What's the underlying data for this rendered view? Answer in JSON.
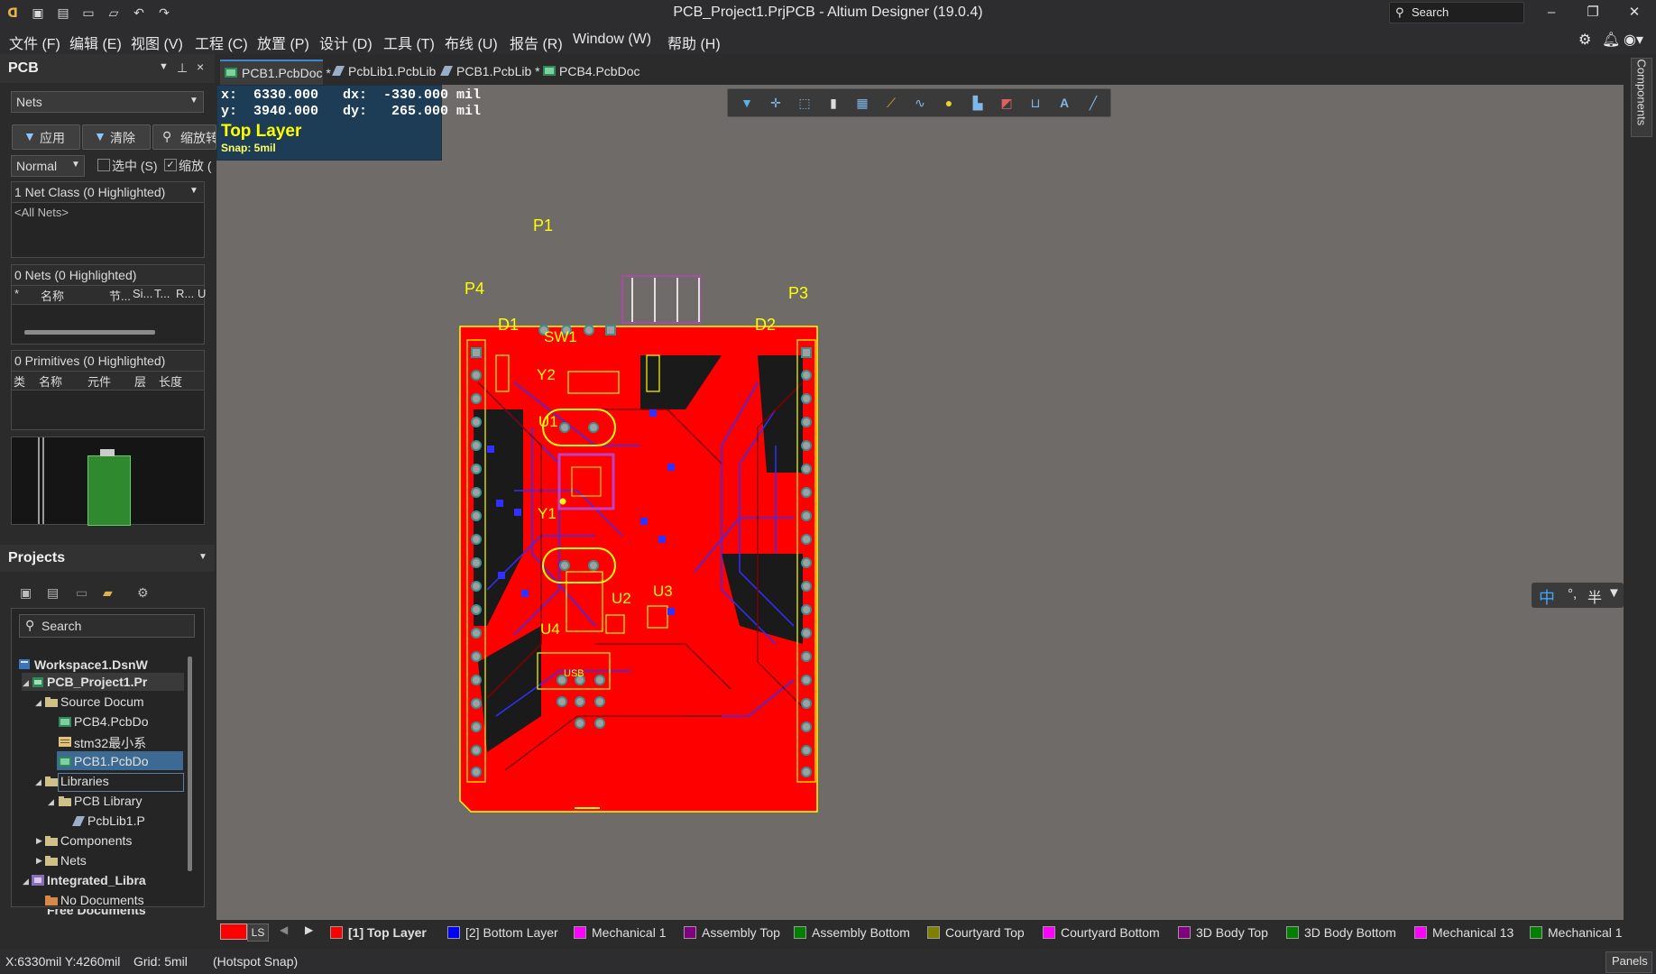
{
  "app": {
    "title": "PCB_Project1.PrjPCB - Altium Designer (19.0.4)",
    "search_placeholder": "Search"
  },
  "menu": [
    "文件 (F)",
    "编辑 (E)",
    "视图 (V)",
    "工程 (C)",
    "放置 (P)",
    "设计 (D)",
    "工具 (T)",
    "布线 (U)",
    "报告 (R)",
    "Window (W)",
    "帮助 (H)"
  ],
  "pcb_panel": {
    "title": "PCB",
    "mode_select": "Nets",
    "apply_label": "应用",
    "clear_label": "清除",
    "zoom_label": "缩放转",
    "normal_select": "Normal",
    "select_check": "选中 (S)",
    "zoom_check": "缩放 (",
    "net_class_header": "1 Net Class (0 Highlighted)",
    "all_nets": "<All Nets>",
    "nets_header": "0 Nets (0 Highlighted)",
    "nets_columns": [
      "*",
      "名称",
      "节...",
      "Si...",
      "T...",
      "R...",
      "U"
    ],
    "primitives_header": "0 Primitives (0 Highlighted)",
    "primitives_columns": [
      "类",
      "名称",
      "元件",
      "层",
      "长度"
    ]
  },
  "projects_panel": {
    "title": "Projects",
    "search_placeholder": "Search",
    "tree": [
      {
        "label": "Workspace1.DsnW",
        "level": 0,
        "bold": true
      },
      {
        "label": "PCB_Project1.Pr",
        "level": 1,
        "bold": true
      },
      {
        "label": "Source Docum",
        "level": 2
      },
      {
        "label": "PCB4.PcbDo",
        "level": 3
      },
      {
        "label": "stm32最小系",
        "level": 3
      },
      {
        "label": "PCB1.PcbDo",
        "level": 3,
        "selected": true
      },
      {
        "label": "Libraries",
        "level": 2
      },
      {
        "label": "PCB Library",
        "level": 3
      },
      {
        "label": "PcbLib1.Pc",
        "level": 4
      },
      {
        "label": "Components",
        "level": 2
      },
      {
        "label": "Nets",
        "level": 2
      },
      {
        "label": "Integrated_Libra",
        "level": 1,
        "bold": true
      },
      {
        "label": "No Documents",
        "level": 2
      },
      {
        "label": "Free Documents",
        "level": 1,
        "bold": true
      }
    ]
  },
  "tabs": [
    {
      "label": "PCB1.PcbDoc *",
      "active": true
    },
    {
      "label": "PcbLib1.PcbLib"
    },
    {
      "label": "PCB1.PcbLib *"
    },
    {
      "label": "PCB4.PcbDoc"
    }
  ],
  "headsup": {
    "line1": "x:  6330.000   dx:  -330.000 mil",
    "line2": "y:  3940.000   dy:   265.000 mil",
    "layer": "Top Layer",
    "snap": "Snap: 5mil"
  },
  "designators": [
    "P1",
    "P4",
    "P3",
    "D1",
    "D2",
    "SW1",
    "Y2",
    "U1",
    "Y1",
    "U2",
    "U3",
    "U4",
    "USB"
  ],
  "right_panel_label": "Components",
  "ime": {
    "mode": "中",
    "punct": "°,",
    "width": "半"
  },
  "layers": {
    "ls_label": "LS",
    "items": [
      {
        "label": "[1] Top Layer",
        "color": "#ff0000",
        "active": true
      },
      {
        "label": "[2] Bottom Layer",
        "color": "#0000ff"
      },
      {
        "label": "Mechanical 1",
        "color": "#ff00ff"
      },
      {
        "label": "Assembly Top",
        "color": "#800080"
      },
      {
        "label": "Assembly Bottom",
        "color": "#008000"
      },
      {
        "label": "Courtyard Top",
        "color": "#808000"
      },
      {
        "label": "Courtyard Bottom",
        "color": "#ff00ff"
      },
      {
        "label": "3D Body Top",
        "color": "#800080"
      },
      {
        "label": "3D Body Bottom",
        "color": "#008000"
      },
      {
        "label": "Mechanical 13",
        "color": "#ff00ff"
      },
      {
        "label": "Mechanical 1",
        "color": "#008000"
      }
    ]
  },
  "status": {
    "coords": "X:6330mil Y:4260mil",
    "grid": "Grid: 5mil",
    "snap": "(Hotspot Snap)",
    "panels": "Panels"
  }
}
